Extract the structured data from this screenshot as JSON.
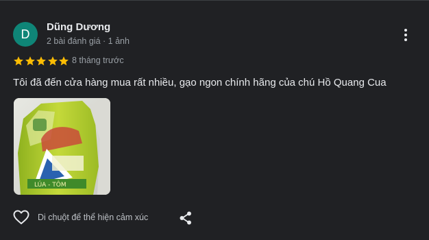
{
  "review": {
    "author_initial": "D",
    "author_name": "Dũng Dương",
    "author_meta": "2 bài đánh giá · 1 ảnh",
    "rating": 5,
    "rating_max": 5,
    "time_ago": "8 tháng trước",
    "text": "Tôi đã đến cửa hàng mua rất nhiều, gạo ngon chính hãng của chú Hồ Quang Cua",
    "photo_label": "LÚA - TÔM",
    "react_label": "Di chuột để thể hiện cảm xúc"
  },
  "colors": {
    "background": "#202124",
    "avatar": "#0f8577",
    "star": "#fbbc04",
    "text_primary": "#e8eaed",
    "text_secondary": "#9aa0a6"
  },
  "icons": {
    "more": "more-vertical-icon",
    "star": "star-icon",
    "heart": "heart-outline-icon",
    "share": "share-icon"
  }
}
